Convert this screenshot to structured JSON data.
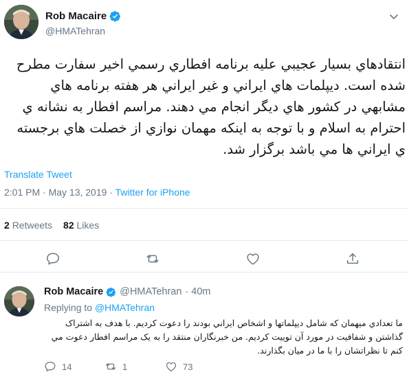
{
  "tweet": {
    "author_name": "Rob Macaire",
    "author_handle": "@HMATehran",
    "text": "انتقادهاي بسيار عجيبي عليه برنامه افطاري رسمي اخير سفارت مطرح شده است. ديپلمات هاي ايراني و غير ايراني هر هفته برنامه هاي مشابهي در كشور هاي ديگر انجام مي دهند. مراسم افطار به نشانه ي احترام به اسلام و با توجه به اينكه مهمان نوازي از خصلت هاي برجسته ي ايراني ها مي باشد برگزار شد.",
    "translate_label": "Translate Tweet",
    "time": "2:01 PM · May 13, 2019 · ",
    "source": "Twitter for iPhone",
    "retweets_count": "2",
    "retweets_label": "Retweets",
    "likes_count": "82",
    "likes_label": "Likes"
  },
  "reply": {
    "author_name": "Rob Macaire",
    "author_handle": "@HMATehran",
    "age": "· 40m",
    "replying_to_prefix": "Replying to",
    "replying_to_handle": "@HMATehran",
    "text": "ما تعدادي ميهمان كه شامل ديپلماتها و اشخاص ايراني بودند را دعوت كرديم. با هدف به اشتراک گذاشتن و شفافيت در مورد آن توييت كرديم. من خبرنگاران منتقد را به يک مراسم افطار دعوت مي كنم تا نظراتشان را با ما در ميان بگذارند.",
    "replies": "14",
    "retweets": "1",
    "likes": "73"
  },
  "icons": {
    "verified": "verified-badge-icon",
    "chevron": "chevron-down-icon",
    "reply": "reply-icon",
    "retweet": "retweet-icon",
    "like": "heart-icon",
    "share": "share-icon"
  },
  "colors": {
    "accent": "#1da1f2",
    "secondary_text": "#657786",
    "divider": "#e6ecf0"
  }
}
